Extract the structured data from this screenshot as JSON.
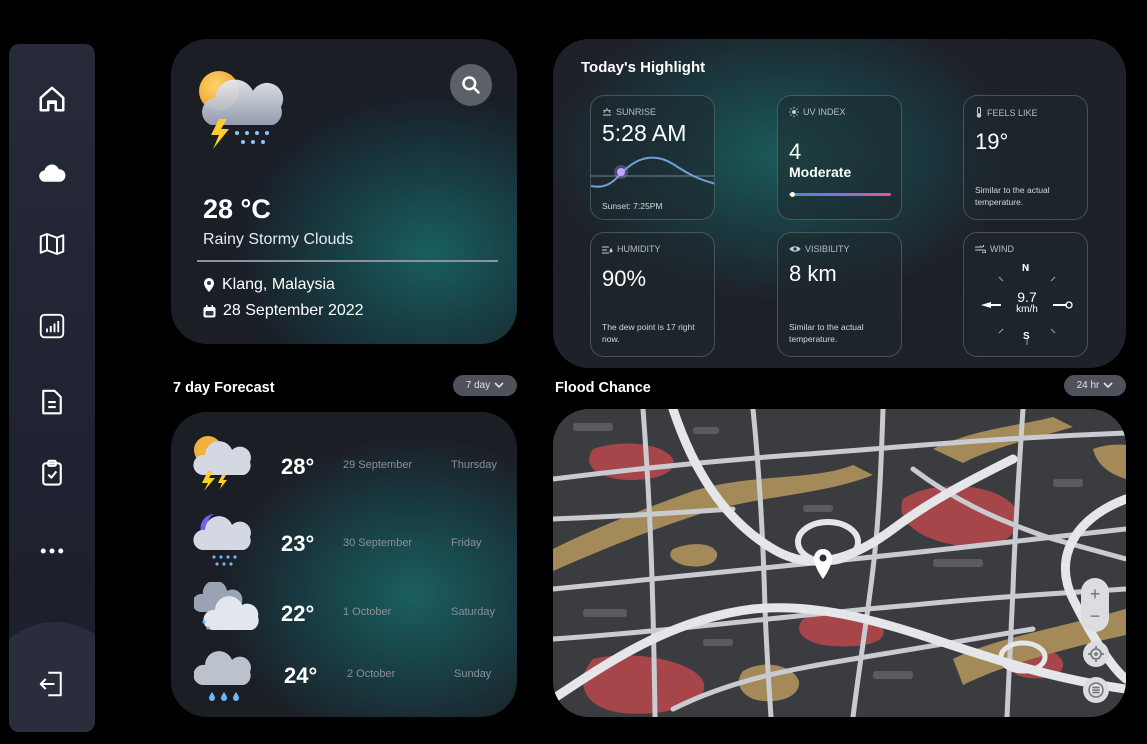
{
  "sidebar": {
    "items": [
      {
        "name": "home",
        "icon": "home-icon"
      },
      {
        "name": "weather",
        "icon": "cloud-icon"
      },
      {
        "name": "map",
        "icon": "map-icon"
      },
      {
        "name": "chart",
        "icon": "chart-icon"
      },
      {
        "name": "document",
        "icon": "document-icon"
      },
      {
        "name": "clipboard",
        "icon": "clipboard-check-icon"
      },
      {
        "name": "more",
        "icon": "more-icon"
      }
    ],
    "logout_icon": "logout-icon"
  },
  "current": {
    "temperature": "28 °C",
    "description": "Rainy Stormy Clouds",
    "location": "Klang, Malaysia",
    "date": "28 September 2022"
  },
  "highlights": {
    "title": "Today's Highlight",
    "sunrise": {
      "label": "SUNRISE",
      "value": "5:28 AM",
      "note": "Sunset: 7:25PM"
    },
    "uv": {
      "label": "UV INDEX",
      "value": "4",
      "level": "Moderate"
    },
    "feels_like": {
      "label": "FEELS LIKE",
      "value": "19°",
      "note": "Similar to the actual temperature."
    },
    "humidity": {
      "label": "HUMIDITY",
      "value": "90%",
      "note": "The dew point is 17 right now."
    },
    "visibility": {
      "label": "VISIBILITY",
      "value": "8 km",
      "note": "Similar to the actual temperature."
    },
    "wind": {
      "label": "WIND",
      "speed": "9.7",
      "unit": "km/h",
      "north": "N",
      "south": "S"
    }
  },
  "forecast": {
    "title": "7 day Forecast",
    "range_label": "7 day",
    "days": [
      {
        "temp": "28°",
        "date": "29 September",
        "day": "Thursday",
        "icon": "storm-sun-icon"
      },
      {
        "temp": "23°",
        "date": "30 September",
        "day": "Friday",
        "icon": "night-rain-icon"
      },
      {
        "temp": "22°",
        "date": "1 October",
        "day": "Saturday",
        "icon": "cloudy-rain-icon"
      },
      {
        "temp": "24°",
        "date": "2 October",
        "day": "Sunday",
        "icon": "rain-icon"
      }
    ]
  },
  "flood": {
    "title": "Flood Chance",
    "range_label": "24 hr",
    "zoom_in": "+",
    "zoom_out": "−"
  },
  "colors": {
    "background": "#000000",
    "card": "#1c1e26",
    "teal_glow": "#1b5f5f",
    "uv_gradient_start": "#3a8ee6",
    "uv_gradient_end": "#e0559a",
    "flood_red": "#a6454a",
    "flood_tan": "#a38a58"
  }
}
